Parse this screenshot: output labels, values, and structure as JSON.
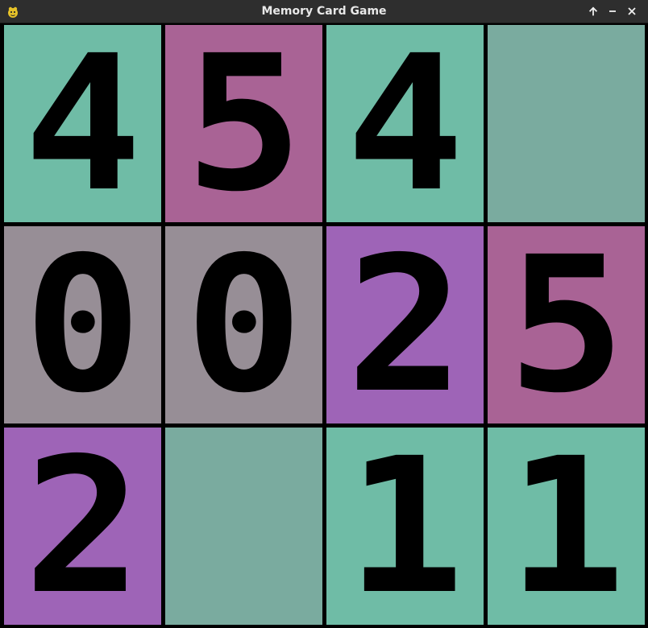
{
  "window": {
    "title": "Memory Card Game",
    "icon": "pygame-snake-icon",
    "controls": [
      "maximize-icon",
      "minimize-icon",
      "close-icon"
    ]
  },
  "colors": {
    "titlebar": "#2e2e2e",
    "title_text": "#e8e8e8",
    "grid_lines": "#000000",
    "face_down": "#7aab9f",
    "teal": "#6fbca6",
    "pink": "#a96395",
    "gray": "#978e96",
    "purple": "#9e64b7"
  },
  "board": {
    "rows": 3,
    "cols": 4,
    "cards": [
      {
        "value": "4",
        "state": "revealed",
        "color": "#6fbca6"
      },
      {
        "value": "5",
        "state": "revealed",
        "color": "#a96395"
      },
      {
        "value": "4",
        "state": "revealed",
        "color": "#6fbca6"
      },
      {
        "value": "",
        "state": "hidden",
        "color": "#7aab9f"
      },
      {
        "value": "0",
        "state": "revealed",
        "color": "#978e96"
      },
      {
        "value": "0",
        "state": "revealed",
        "color": "#978e96"
      },
      {
        "value": "2",
        "state": "revealed",
        "color": "#9e64b7"
      },
      {
        "value": "5",
        "state": "revealed",
        "color": "#a96395"
      },
      {
        "value": "2",
        "state": "revealed",
        "color": "#9e64b7"
      },
      {
        "value": "",
        "state": "hidden",
        "color": "#7aab9f"
      },
      {
        "value": "1",
        "state": "revealed",
        "color": "#6fbca6"
      },
      {
        "value": "1",
        "state": "revealed",
        "color": "#6fbca6"
      }
    ]
  }
}
